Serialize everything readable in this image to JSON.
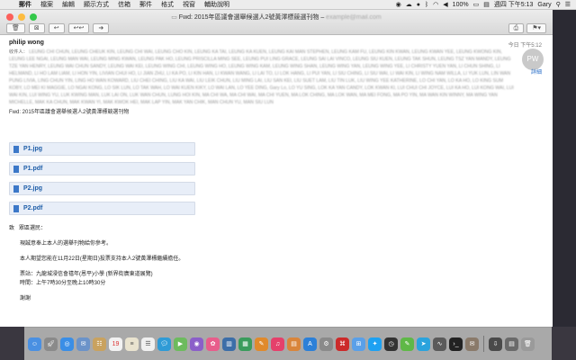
{
  "menubar": {
    "app": "郵件",
    "items": [
      "檔案",
      "編輯",
      "顯示方式",
      "信箱",
      "郵件",
      "格式",
      "視窗",
      "輔助說明"
    ],
    "battery": "100%",
    "clock": "週四 下午5:13",
    "user": "Gary"
  },
  "window": {
    "title_prefix": "Fwd: 2015年區議會選舉候選人2號黃澤標競選刊物 –",
    "title_blurred": "example@mail.com",
    "received": "今日 下午5:12",
    "avatar_initials": "PW",
    "details": "詳細"
  },
  "message": {
    "sender": "philip wong",
    "recipients_label": "收件人：",
    "recipients_blurred": "LEUNG CHI CHUN, LEUNG CHEUK KIN, LEUNG CHI WAI, LEUNG CHO KIN, LEUNG KA TAI, LEUNG KA KUEN, LEUNG KAI MAN STEPHEN, LEUNG KAM FU, LEUNG KIN KWAN, LEUNG KWAN YEE, LEUNG KWONG KIN, LEUNG LEE NGAI, LEUNG MAN WAI, LEUNG MING KWAN, LEUNG PAK HO, LEUNG PRISCILLA MING SEE, LEUNG PUI LING GRACE, LEUNG SAI LAI VINCO, LEUNG SIU KUEN, LEUNG TAK SHUN, LEUNG TSZ YAN MANDY, LEUNG TZE YAN HENRY, LEUNG WAI CHUN SANDY, LEUNG WAI KEI, LEUNG WING CHI, LEUNG WING HO, LEUNG WING KAM, LEUNG WING SHAN, LEUNG WING YAN, LEUNG WING YEE, LI CHRISTY YUEN YAN, LI CHUN SHING, LI HELMAND, LI HO LAM LIAM, LI HON YIN, LIVIAN CHUI HO, LI JIAN ZHU, LI KA PO, LI KIN HAN, LI KWAN WANG, LI LAI TO, LI LOK HANG, LI PUI YAN, LI SIU CHING, LI SIU WAI, LI WAI KIN, LI WING NAM WILLA, LI YUK LUN, LIN WAN PUNG LIVIA, LING CHUN YIN, LING HO WAN KOWARD, LIU CHEI CHING, LIU KA WAI, LIU LEIK CHUN, LIU MING LAI, LIU SAN KEI, LIU SUET LAM, LIU TIN LUK, LIU WING YEE KATHERINE, LO CHI YAN, LO KA HO, LO KING SUM KOBY, LO MEI KI MAGGIE, LO NGAI KONG, LO SIK LUN, LO TAK WAH, LO WAI KUEN KIKY, LO WAI LAN, LO YEE DING, Gary Lo, LO YU SING, LOK KA YAN CANDY, LOK KWAN KI, LUI CHUI CHI JOYCE, LUI KA HO, LUI KONG WAI, LUI WAI KIN, LUI WING YU, LUK KWING MAN, LUK LAI ON, LUK WAN CHUN, LUNG HOI KIN, MA CHI WA, MA CHI WAI, MA CHI YUEN, MA LOK CHING, MA LOK WAN, MA MEI FONG, MA PO YIN, MA WAN KIN WINNY, MA WING YAN MICHELLE, MAK KA CHUN, MAK KWAN YI, MAK KWOK HEI, MAK LAP YIN, MAK YAN CHIK, MAN CHUN YU, MAN SIU LUN",
    "subject": "Fwd: 2015年區議會選舉候選人2號黃澤標競選刊物"
  },
  "attachments": [
    {
      "name": "P1.jpg"
    },
    {
      "name": "P1.pdf"
    },
    {
      "name": "P2.jpg"
    },
    {
      "name": "P2.pdf"
    }
  ],
  "body": {
    "greeting_prefix": "致",
    "greeting": "眾區選民：",
    "line1": "現誠意奉上本人的選舉刊物給你參考。",
    "line2": "本人期望您能在11月22日(星期日)投票支持本人2號黃澤標繼續擔任。",
    "line3": "票站：九龍城浸信會禧年(恩平)小學 (新界街廣東道展覽)",
    "line4": "時間：上午7時30分至晚上10時30分",
    "line5": "謝謝"
  },
  "colors": {
    "attachment_bg": "#e8eef8",
    "attachment_text": "#1f5ea8",
    "link": "#2a6fc9"
  }
}
